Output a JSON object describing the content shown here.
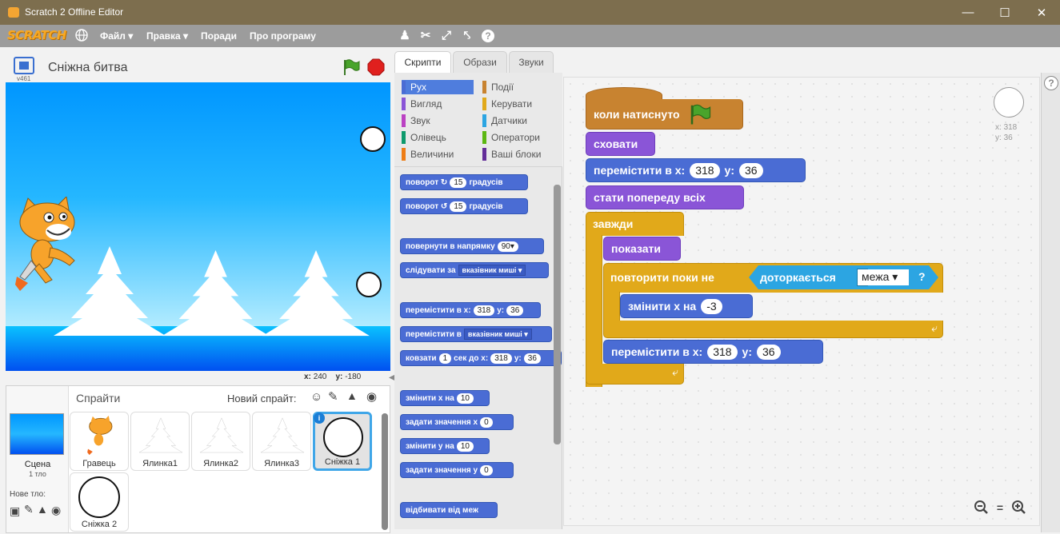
{
  "window": {
    "title": "Scratch 2 Offline Editor"
  },
  "menubar": {
    "logo": "SCRATCH",
    "menus": [
      "Файл ▾",
      "Правка ▾",
      "Поради",
      "Про програму"
    ]
  },
  "stage": {
    "version": "v461",
    "project_title": "Сніжна битва",
    "x_label": "x:",
    "x_value": "240",
    "y_label": "y:",
    "y_value": "-180"
  },
  "tabs": [
    "Скрипти",
    "Образи",
    "Звуки"
  ],
  "categories": {
    "left": [
      "Рух",
      "Вигляд",
      "Звук",
      "Олівець",
      "Величини"
    ],
    "right": [
      "Події",
      "Керувати",
      "Датчики",
      "Оператори",
      "Ваші блоки"
    ]
  },
  "palette": {
    "turn_right": {
      "a": "поворот",
      "val": "15",
      "b": "градусів"
    },
    "turn_left": {
      "a": "поворот",
      "val": "15",
      "b": "градусів"
    },
    "point_dir": {
      "a": "повернути в напрямку",
      "val": "90▾"
    },
    "follow": {
      "a": "слідувати за",
      "dd": "вказівник миші ▾"
    },
    "goto_xy": {
      "a": "перемістити в x:",
      "x": "318",
      "b": "y:",
      "y": "36"
    },
    "goto_dd": {
      "a": "перемістити в",
      "dd": "вказівник миші ▾"
    },
    "glide": {
      "a": "ковзати",
      "secs": "1",
      "b": "сек до x:",
      "x": "318",
      "c": "y:",
      "y": "36"
    },
    "change_x": {
      "a": "змінити x на",
      "val": "10"
    },
    "set_x": {
      "a": "задати значення x",
      "val": "0"
    },
    "change_y": {
      "a": "змінити y на",
      "val": "10"
    },
    "set_y": {
      "a": "задати значення y",
      "val": "0"
    },
    "bounce": {
      "a": "відбивати від меж"
    }
  },
  "script": {
    "hat": "коли натиснуто",
    "hide": "сховати",
    "goto1": {
      "a": "перемістити в x:",
      "x": "318",
      "b": "y:",
      "y": "36"
    },
    "front": "стати попереду всіх",
    "forever": "завжди",
    "show": "показати",
    "repeat_until": "повторити поки не",
    "touching": "доторкається",
    "touching_dd": "межа ▾",
    "touching_q": "?",
    "change_x": {
      "a": "змінити x на",
      "val": "-3"
    },
    "goto2": {
      "a": "перемістити в x:",
      "x": "318",
      "b": "y:",
      "y": "36"
    }
  },
  "sprite_info": {
    "x_label": "x:",
    "x": "318",
    "y_label": "y:",
    "y": "36"
  },
  "sprites_pane": {
    "header": "Спрайти",
    "new_sprite": "Новий спрайт:",
    "stage_label": "Сцена",
    "stage_sub": "1 тло",
    "new_backdrop": "Нове тло:",
    "sprites": [
      "Гравець",
      "Ялинка1",
      "Ялинка2",
      "Ялинка3",
      "Сніжка 1",
      "Сніжка 2"
    ]
  },
  "colors": {
    "motion": "#4a6cd4",
    "looks": "#8a55d7",
    "events": "#c88330",
    "control": "#e1a91a",
    "sensing": "#2ca5e2",
    "sound": "#bb42c3",
    "pen": "#0e9a6c",
    "data": "#ee7d16",
    "operators": "#5cb712",
    "more": "#632d99"
  }
}
